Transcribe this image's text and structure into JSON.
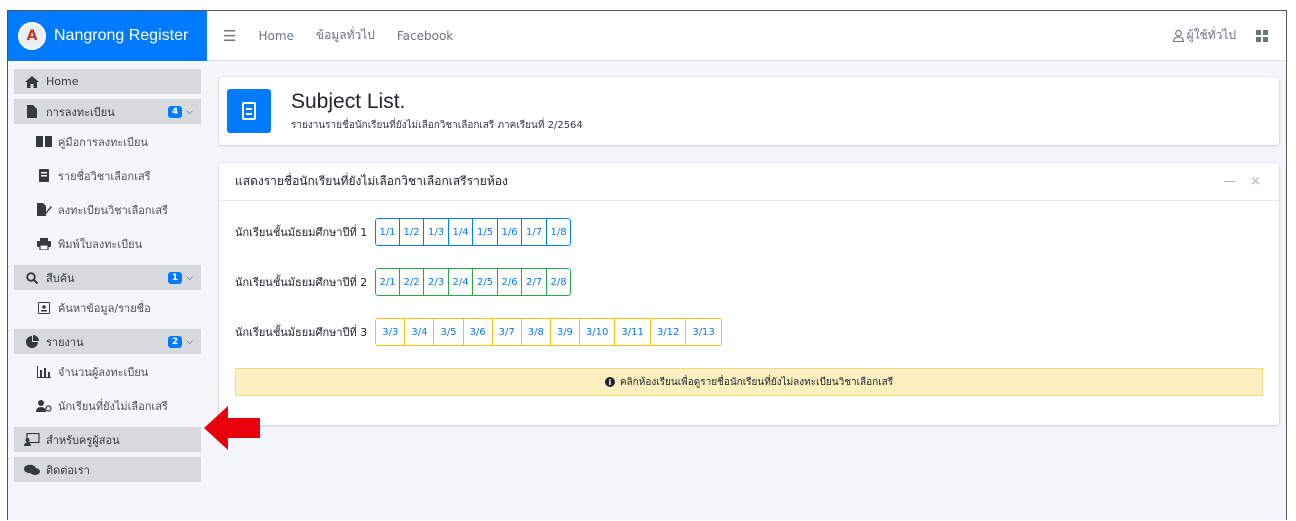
{
  "brand": {
    "title": "Nangrong Register",
    "logo_glyph": "A"
  },
  "topbar": {
    "links": [
      "Home",
      "ข้อมูลทั่วไป",
      "Facebook"
    ],
    "user_label": "ผู้ใช้ทั่วไป"
  },
  "sidebar": {
    "items": [
      {
        "label": "Home",
        "icon": "home-icon",
        "type": "top"
      },
      {
        "label": "การลงทะเบียน",
        "icon": "file-icon",
        "type": "top",
        "badge": "4"
      },
      {
        "label": "คู่มือการลงทะเบียน",
        "icon": "book-open-icon",
        "type": "sub"
      },
      {
        "label": "รายชื่อวิชาเลือกเสรี",
        "icon": "book-icon",
        "type": "sub"
      },
      {
        "label": "ลงทะเบียนวิชาเลือกเสรี",
        "icon": "edit-file-icon",
        "type": "sub"
      },
      {
        "label": "พิมพ์ใบลงทะเบียน",
        "icon": "print-icon",
        "type": "sub"
      },
      {
        "label": "สืบค้น",
        "icon": "search-icon",
        "type": "top",
        "badge": "1"
      },
      {
        "label": "ค้นหาข้อมูล/รายชื่อ",
        "icon": "id-card-icon",
        "type": "sub"
      },
      {
        "label": "รายงาน",
        "icon": "pie-chart-icon",
        "type": "top",
        "badge": "2"
      },
      {
        "label": "จำนวนผู้ลงทะเบียน",
        "icon": "bar-chart-icon",
        "type": "sub"
      },
      {
        "label": "นักเรียนที่ยังไม่เลือกเสรี",
        "icon": "user-icon",
        "type": "sub"
      },
      {
        "label": "สำหรับครูผู้สอน",
        "icon": "teacher-icon",
        "type": "top"
      },
      {
        "label": "ติดต่อเรา",
        "icon": "comments-icon",
        "type": "top"
      }
    ]
  },
  "header": {
    "title": "Subject List.",
    "subtitle": "รายงานรายชื่อนักเรียนที่ยังไม่เลือกวิชาเลือกเสรี ภาคเรียนที่ 2/2564"
  },
  "card": {
    "title": "แสดงรายชื่อนักเรียนที่ยังไม่เลือกวิชาเลือกเสรีรายห้อง",
    "minimize_glyph": "—",
    "close_glyph": "×",
    "grades": [
      {
        "label": "นักเรียนชั้นมัธยมศึกษาปีที่ 1",
        "rooms": [
          "1/1",
          "1/2",
          "1/3",
          "1/4",
          "1/5",
          "1/6",
          "1/7",
          "1/8"
        ]
      },
      {
        "label": "นักเรียนชั้นมัธยมศึกษาปีที่ 2",
        "rooms": [
          "2/1",
          "2/2",
          "2/3",
          "2/4",
          "2/5",
          "2/6",
          "2/7",
          "2/8"
        ]
      },
      {
        "label": "นักเรียนชั้นมัธยมศึกษาปีที่ 3",
        "rooms": [
          "3/3",
          "3/4",
          "3/5",
          "3/6",
          "3/7",
          "3/8",
          "3/9",
          "3/10",
          "3/11",
          "3/12",
          "3/13"
        ]
      }
    ],
    "alert": "คลิกห้องเรียนเพื่อดูรายชื่อนักเรียนที่ยังไม่ลงทะเบียนวิชาเลือกเสรี"
  },
  "colors": {
    "primary": "#007bff",
    "grade1_border": "#007bff",
    "grade2_border": "#28a745",
    "grade3_border": "#ffc107",
    "arrow": "#e8000b"
  }
}
